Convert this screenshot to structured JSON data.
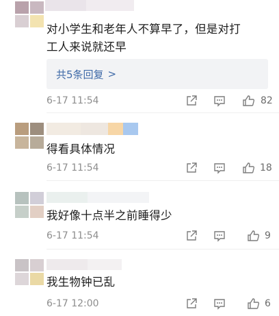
{
  "comments": [
    {
      "text_lines": [
        "对小学生和老年人不算早了，但是对打",
        "工人来说就还早"
      ],
      "replies_label": "共5条回复",
      "replies_chevron": ">",
      "time": "6-17 11:54",
      "likes": "82"
    },
    {
      "text_lines": [
        "得看具体情况"
      ],
      "time": "6-17 11:54",
      "likes": "18"
    },
    {
      "text_lines": [
        "我好像十点半之前睡得少"
      ],
      "time": "6-17 11:54",
      "likes": "9"
    },
    {
      "text_lines": [
        "我生物钟已乱"
      ],
      "time": "6-17 12:00",
      "likes": "6"
    }
  ],
  "icons": [
    "share-icon",
    "comment-icon",
    "thumbs-up-icon"
  ],
  "colors": {
    "reply_link": "#3f6aa8",
    "meta_text": "#8d8d8d",
    "reply_bg": "#f2f3f5"
  }
}
